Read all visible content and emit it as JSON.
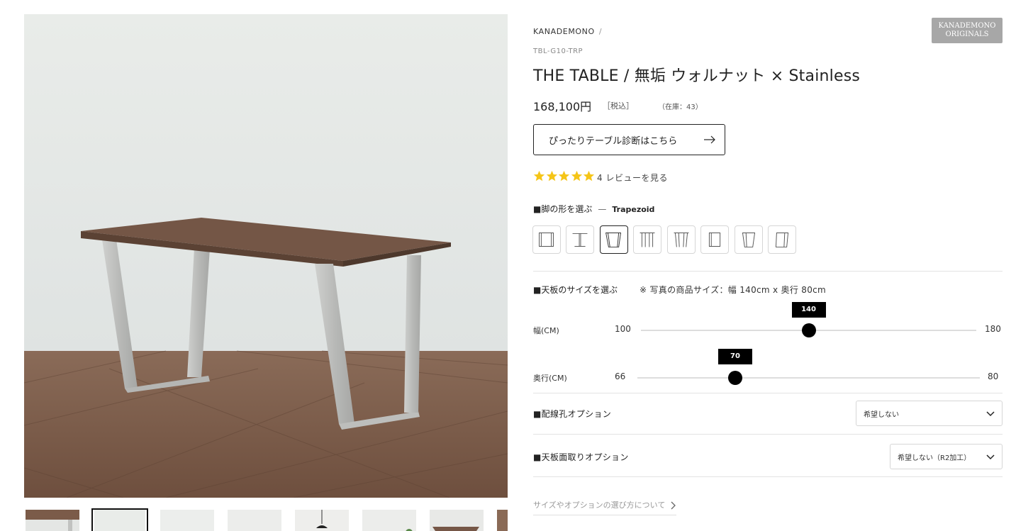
{
  "gallery": {
    "main_alt": "THE TABLE walnut stainless trapezoid",
    "thumbnail_count": 8,
    "active_thumbnail": 2
  },
  "product": {
    "brand": "KANADEMONO",
    "brand_separator": "/",
    "badge_line1": "KANADEMONO",
    "badge_line2": "ORIGINALS",
    "sku": "TBL-G10-TRP",
    "title": "THE TABLE / 無垢 ウォルナット × Stainless",
    "price": "168,100円",
    "tax": "［税込］",
    "stock": "（在庫：43）"
  },
  "diagnosis_button": {
    "label": "ぴったりテーブル診断はこちら",
    "arrow": "→"
  },
  "reviews": {
    "rating": 5,
    "count": "4",
    "link": "レビューを見る",
    "star_color": "#f5c518"
  },
  "leg_shape": {
    "label": "■脚の形を選ぶ",
    "dash": "—",
    "selected": "Trapezoid",
    "options": [
      "square",
      "t-shape",
      "trapezoid",
      "four-leg",
      "four-leg-tapered",
      "square-frame",
      "trapezoid-frame",
      "square-frame-offset"
    ],
    "active_index": 2
  },
  "size": {
    "label": "■天板のサイズを選ぶ",
    "note": "※ 写真の商品サイズ：幅 140cm x 奥行 80cm",
    "width": {
      "name": "幅(CM)",
      "min": "100",
      "max": "180",
      "value": "140"
    },
    "depth": {
      "name": "奥行(CM)",
      "min": "66",
      "max": "80",
      "value": "70"
    }
  },
  "wiring_option": {
    "label": "■配線孔オプション",
    "value": "希望しない"
  },
  "chamfer_option": {
    "label": "■天板面取りオプション",
    "value": "希望しない（R2加工）"
  },
  "help": {
    "link": "サイズやオプションの選び方について"
  },
  "colors": {
    "accent": "#000000",
    "badge": "#a7a7a7",
    "walnut": "#6f5142",
    "floor": "#7a5a46"
  }
}
